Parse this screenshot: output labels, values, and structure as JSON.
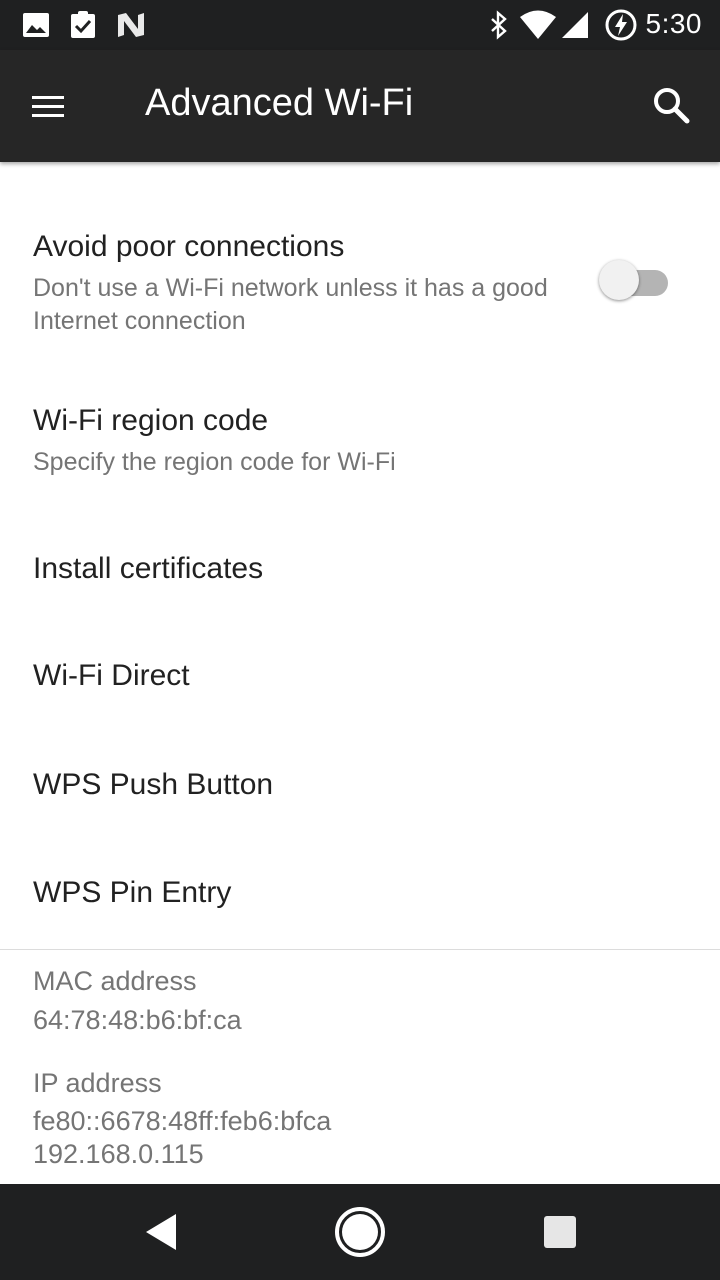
{
  "status_bar": {
    "time": "5:30",
    "left_icons": [
      "image-icon",
      "clipboard-check-icon",
      "n-logo-icon"
    ],
    "right_icons": [
      "bluetooth-icon",
      "wifi-signal-icon",
      "cell-signal-icon",
      "battery-saver-icon"
    ]
  },
  "app_bar": {
    "title": "Advanced Wi-Fi",
    "menu_icon": "menu-icon",
    "search_icon": "search-icon",
    "background": "#262626"
  },
  "preferences": [
    {
      "title": "Avoid poor connections",
      "summary": "Don't use a Wi-Fi network unless it has a good Internet connection",
      "switch_on": false
    },
    {
      "title": "Wi-Fi region code",
      "summary": "Specify the region code for Wi-Fi"
    },
    {
      "title": "Install certificates"
    },
    {
      "title": "Wi-Fi Direct"
    },
    {
      "title": "WPS Push Button"
    },
    {
      "title": "WPS Pin Entry"
    }
  ],
  "info": {
    "mac_label": "MAC address",
    "mac_value": "64:78:48:b6:bf:ca",
    "ip_label": "IP address",
    "ip_value_v6": "fe80::6678:48ff:feb6:bfca",
    "ip_value_v4": "192.168.0.115"
  },
  "nav_bar": {
    "back_icon": "back-triangle-icon",
    "home_icon": "home-circle-icon",
    "recents_icon": "recents-square-icon"
  }
}
